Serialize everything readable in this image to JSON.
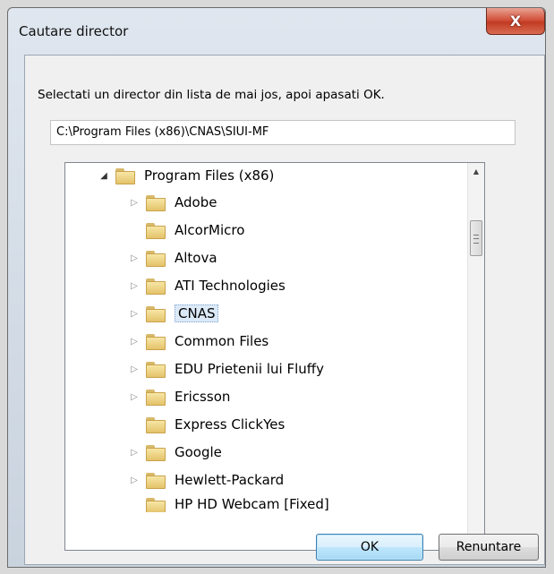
{
  "window": {
    "title": "Cautare director",
    "close_glyph": "X"
  },
  "instruction": "Selectati un director din lista de mai jos, apoi apasati OK.",
  "path_value": "C:\\Program Files (x86)\\CNAS\\SIUI-MF",
  "tree": {
    "root": {
      "label": "Program Files (x86)",
      "expanded": true
    },
    "items": [
      {
        "label": "Adobe",
        "has_children": true
      },
      {
        "label": "AlcorMicro",
        "has_children": false
      },
      {
        "label": "Altova",
        "has_children": true
      },
      {
        "label": "ATI Technologies",
        "has_children": true
      },
      {
        "label": "CNAS",
        "has_children": true,
        "selected": true
      },
      {
        "label": "Common Files",
        "has_children": true
      },
      {
        "label": "EDU Prietenii lui Fluffy",
        "has_children": true
      },
      {
        "label": "Ericsson",
        "has_children": true
      },
      {
        "label": "Express ClickYes",
        "has_children": false
      },
      {
        "label": "Google",
        "has_children": true
      },
      {
        "label": "Hewlett-Packard",
        "has_children": true
      },
      {
        "label": "HP HD Webcam [Fixed]",
        "has_children": false
      }
    ]
  },
  "buttons": {
    "ok": "OK",
    "cancel": "Renuntare"
  },
  "icons": {
    "folder": "folder-icon",
    "expand": "triangle-right-icon",
    "collapse": "triangle-down-icon"
  },
  "colors": {
    "accent": "#3c7fb1",
    "close": "#c23b22",
    "selection": "#dceaf8"
  }
}
